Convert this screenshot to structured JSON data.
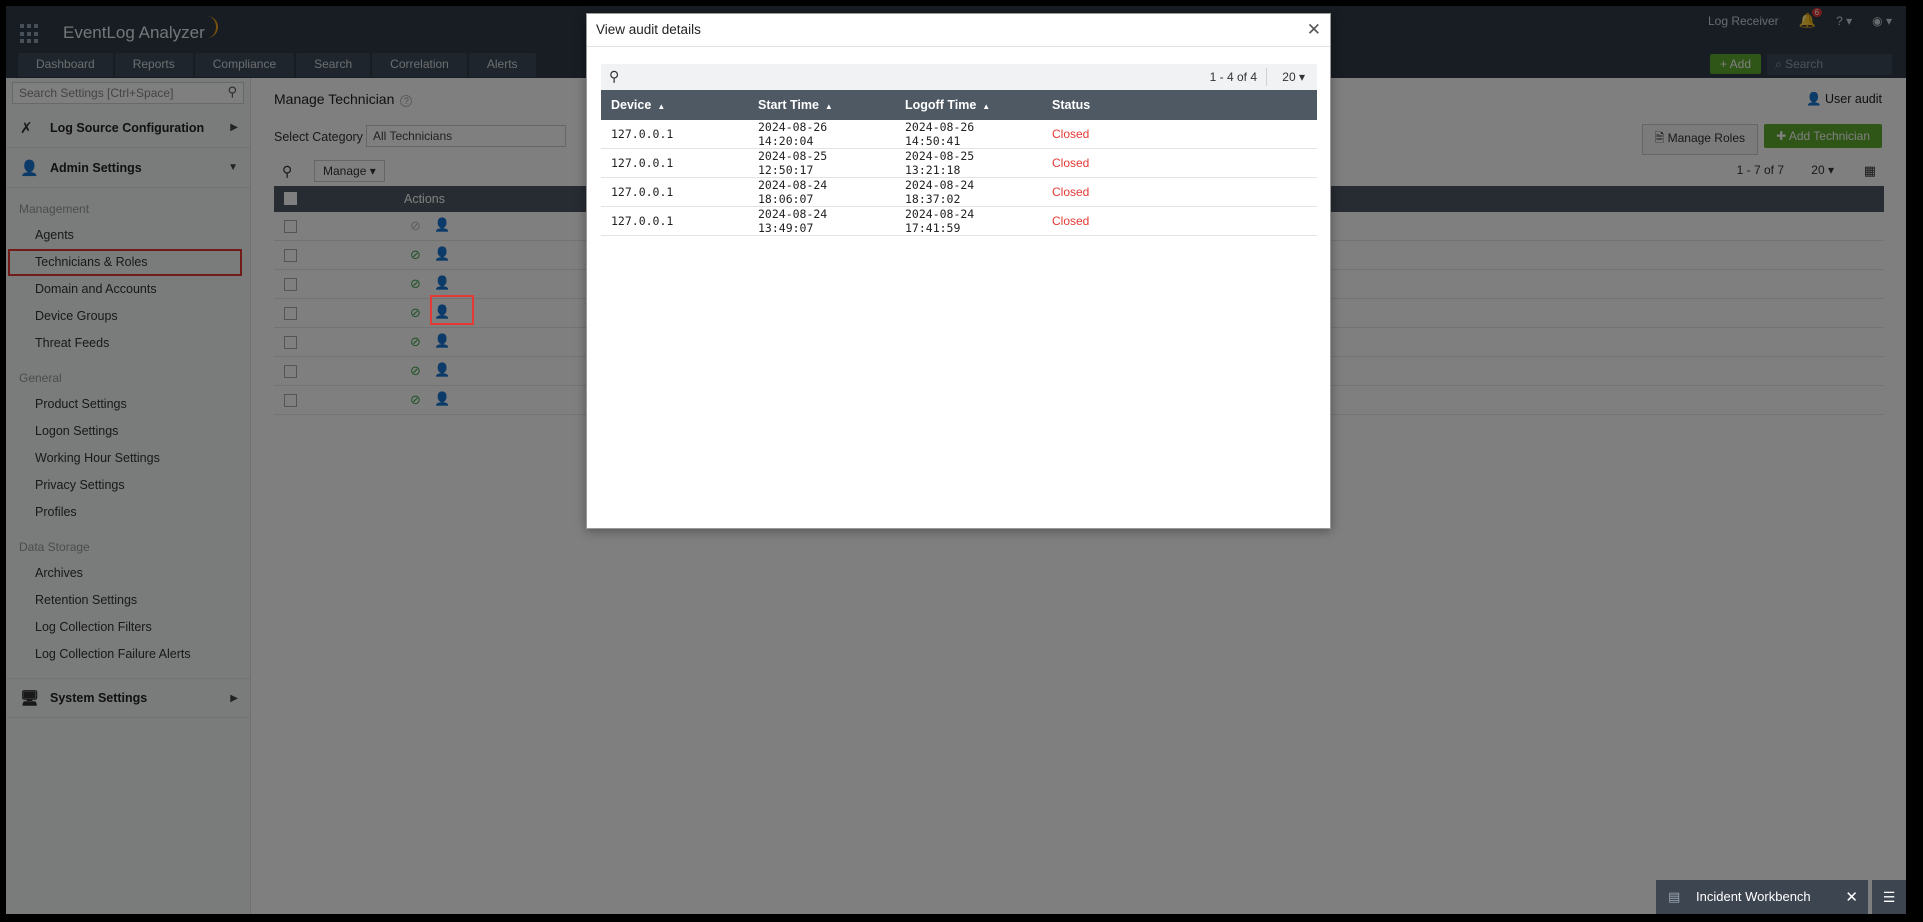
{
  "app": {
    "brand": "EventLog Analyzer",
    "log_receiver": "Log Receiver",
    "bell_count": "6",
    "help": "?",
    "add_button": "+ Add",
    "search_placeholder": "Search",
    "nav_tabs": [
      "Dashboard",
      "Reports",
      "Compliance",
      "Search",
      "Correlation",
      "Alerts"
    ]
  },
  "sidebar": {
    "search_placeholder": "Search Settings [Ctrl+Space]",
    "log_source": "Log Source Configuration",
    "admin_settings": "Admin Settings",
    "system_settings": "System Settings",
    "groups": [
      {
        "label": "Management",
        "items": [
          "Agents",
          "Technicians & Roles",
          "Domain and Accounts",
          "Device Groups",
          "Threat Feeds"
        ]
      },
      {
        "label": "General",
        "items": [
          "Product Settings",
          "Logon Settings",
          "Working Hour Settings",
          "Privacy Settings",
          "Profiles"
        ]
      },
      {
        "label": "Data Storage",
        "items": [
          "Archives",
          "Retention Settings",
          "Log Collection Filters",
          "Log Collection Failure Alerts"
        ]
      }
    ]
  },
  "main": {
    "title": "Manage Technician",
    "user_audit": "User audit",
    "select_category_label": "Select Category",
    "select_category_value": "All Technicians",
    "manage_roles": "Manage Roles",
    "add_technician": "Add Technician",
    "manage_dropdown": "Manage",
    "pagination": "1 - 7 of 7",
    "page_size": "20",
    "actions_header": "Actions",
    "row_count": 7
  },
  "modal": {
    "title": "View audit details",
    "pagination": "1 - 4 of 4",
    "page_size": "20",
    "columns": [
      "Device",
      "Start Time",
      "Logoff Time",
      "Status"
    ],
    "rows": [
      {
        "device": "127.0.0.1",
        "start": "2024-08-26 14:20:04",
        "logoff": "2024-08-26 14:50:41",
        "status": "Closed"
      },
      {
        "device": "127.0.0.1",
        "start": "2024-08-25 12:50:17",
        "logoff": "2024-08-25 13:21:18",
        "status": "Closed"
      },
      {
        "device": "127.0.0.1",
        "start": "2024-08-24 18:06:07",
        "logoff": "2024-08-24 18:37:02",
        "status": "Closed"
      },
      {
        "device": "127.0.0.1",
        "start": "2024-08-24 13:49:07",
        "logoff": "2024-08-24 17:41:59",
        "status": "Closed"
      }
    ]
  },
  "workbench": {
    "label": "Incident Workbench"
  },
  "colors": {
    "accent_green": "#5eab2f",
    "status_red": "#e53935",
    "header_dark": "#4e5964"
  }
}
